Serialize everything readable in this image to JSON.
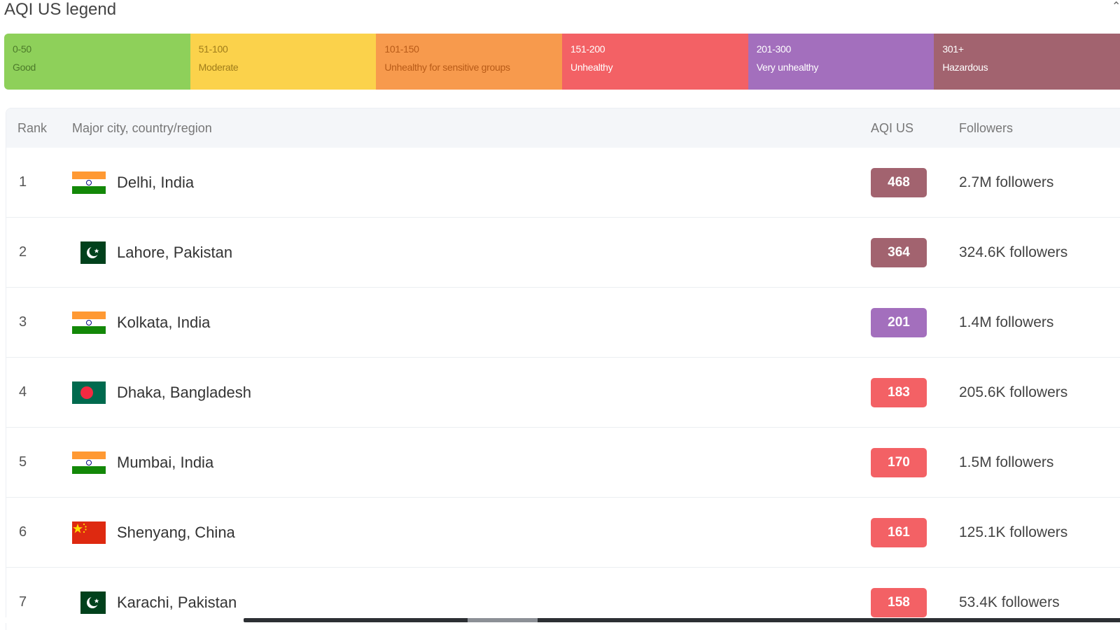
{
  "legend": {
    "title": "AQI US legend",
    "segments": [
      {
        "range": "0-50",
        "label": "Good",
        "bg": "#8ed05a",
        "fg": "#4c7a2a"
      },
      {
        "range": "51-100",
        "label": "Moderate",
        "bg": "#fbd24b",
        "fg": "#a07d1b"
      },
      {
        "range": "101-150",
        "label": "Unhealthy for sensitive groups",
        "bg": "#f79a4d",
        "fg": "#b85b18"
      },
      {
        "range": "151-200",
        "label": "Unhealthy",
        "bg": "#f36165",
        "fg": "#ffffff"
      },
      {
        "range": "201-300",
        "label": "Very unhealthy",
        "bg": "#a36fbd",
        "fg": "#ffffff"
      },
      {
        "range": "301+",
        "label": "Hazardous",
        "bg": "#a2636f",
        "fg": "#ffffff"
      }
    ]
  },
  "table": {
    "headers": {
      "rank": "Rank",
      "city": "Major city, country/region",
      "aqi": "AQI US",
      "followers": "Followers"
    },
    "rows": [
      {
        "rank": "1",
        "city": "Delhi, India",
        "flag": "india-flag-icon",
        "aqi": "468",
        "aqi_color": "#a2636f",
        "followers": "2.7M followers"
      },
      {
        "rank": "2",
        "city": "Lahore, Pakistan",
        "flag": "pakistan-flag-icon",
        "aqi": "364",
        "aqi_color": "#a2636f",
        "followers": "324.6K followers"
      },
      {
        "rank": "3",
        "city": "Kolkata, India",
        "flag": "india-flag-icon",
        "aqi": "201",
        "aqi_color": "#a36fbd",
        "followers": "1.4M followers"
      },
      {
        "rank": "4",
        "city": "Dhaka, Bangladesh",
        "flag": "bangladesh-flag-icon",
        "aqi": "183",
        "aqi_color": "#f36165",
        "followers": "205.6K followers"
      },
      {
        "rank": "5",
        "city": "Mumbai, India",
        "flag": "india-flag-icon",
        "aqi": "170",
        "aqi_color": "#f36165",
        "followers": "1.5M followers"
      },
      {
        "rank": "6",
        "city": "Shenyang, China",
        "flag": "china-flag-icon",
        "aqi": "161",
        "aqi_color": "#f36165",
        "followers": "125.1K followers"
      },
      {
        "rank": "7",
        "city": "Karachi, Pakistan",
        "flag": "pakistan-flag-icon",
        "aqi": "158",
        "aqi_color": "#f36165",
        "followers": "53.4K followers"
      }
    ]
  }
}
